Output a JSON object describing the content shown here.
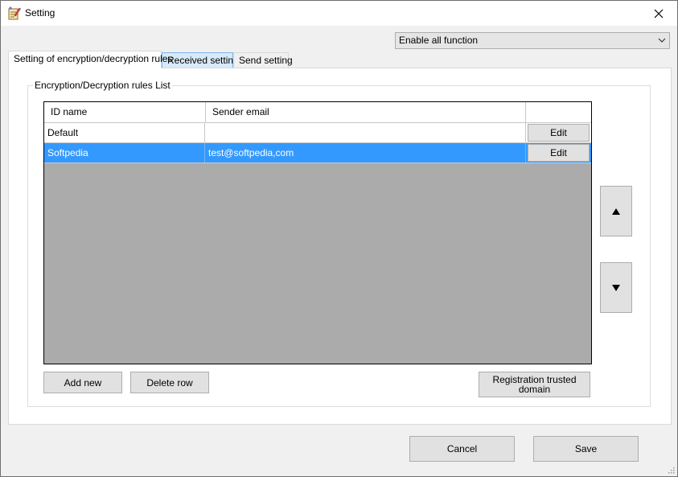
{
  "window": {
    "title": "Setting"
  },
  "icons": {
    "app": "notepad-pen-icon",
    "close": "close-icon",
    "dropdown": "chevron-down-icon",
    "up": "triangle-up-icon",
    "down": "triangle-down-icon"
  },
  "mode_select": {
    "value": "Enable all function"
  },
  "tabs": [
    {
      "label": "Setting of encryption/decryption rules",
      "active": true
    },
    {
      "label": "Received setting",
      "active": false
    },
    {
      "label": "Send setting",
      "active": false
    }
  ],
  "group": {
    "legend": "Encryption/Decryption rules List"
  },
  "grid": {
    "columns": [
      "ID name",
      "Sender email",
      ""
    ],
    "rows": [
      {
        "id_name": "Default",
        "sender_email": "",
        "action": "Edit",
        "selected": false
      },
      {
        "id_name": "Softpedia",
        "sender_email": "test@softpedia,com",
        "action": "Edit",
        "selected": true
      }
    ]
  },
  "buttons": {
    "add_new": "Add new",
    "delete_row": "Delete row",
    "registration_line1": "Registration trusted",
    "registration_line2": "domain",
    "cancel": "Cancel",
    "save": "Save"
  },
  "colors": {
    "selection": "#3399ff",
    "grid_background": "#ababab",
    "hover_tab": "#d8eaf9"
  }
}
